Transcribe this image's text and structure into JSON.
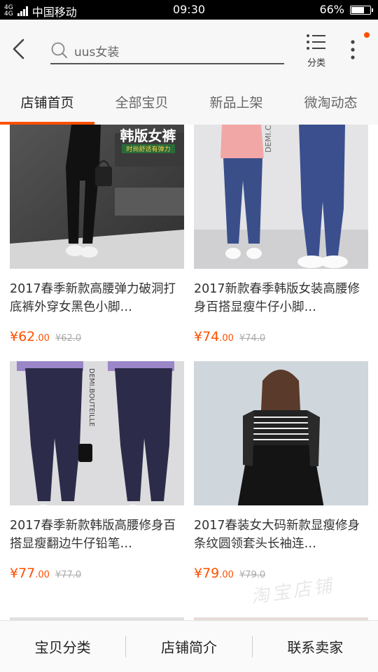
{
  "status_bar": {
    "network": "4G",
    "network_sub": "4G",
    "carrier": "中国移动",
    "time": "09:30",
    "battery": "66%",
    "battery_level": 0.66
  },
  "header": {
    "search_placeholder": "uus女装",
    "category_label": "分类",
    "badge_color": "#ff5000"
  },
  "tabs": [
    {
      "label": "店铺首页",
      "active": true
    },
    {
      "label": "全部宝贝",
      "active": false
    },
    {
      "label": "新品上架",
      "active": false
    },
    {
      "label": "微淘动态",
      "active": false
    }
  ],
  "products": [
    {
      "title": "2017春季新款高腰弹力破洞打底裤外穿女黑色小脚…",
      "price_int": "¥62",
      "price_dec": ".00",
      "old_price": "¥62.0",
      "banner_text": "韩版女裤",
      "banner_sub": "时尚舒适有弹力"
    },
    {
      "title": "2017新款春季韩版女装高腰修身百搭显瘦牛仔小脚…",
      "price_int": "¥74",
      "price_dec": ".00",
      "old_price": "¥74.0",
      "brand_text": "DEMI.CIAVEL"
    },
    {
      "title": "2017春季新款韩版高腰修身百搭显瘦翻边牛仔铅笔…",
      "price_int": "¥77",
      "price_dec": ".00",
      "old_price": "¥77.0",
      "brand_text": "DEMI.BOUTEILLE"
    },
    {
      "title": "2017春装女大码新款显瘦修身条纹圆领套头长袖连…",
      "price_int": "¥79",
      "price_dec": ".00",
      "old_price": "¥79.0"
    }
  ],
  "bottom_bar": {
    "category": "宝贝分类",
    "shop_intro": "店铺简介",
    "contact": "联系卖家"
  },
  "watermark": "淘宝店铺",
  "accent_color": "#ff5000"
}
